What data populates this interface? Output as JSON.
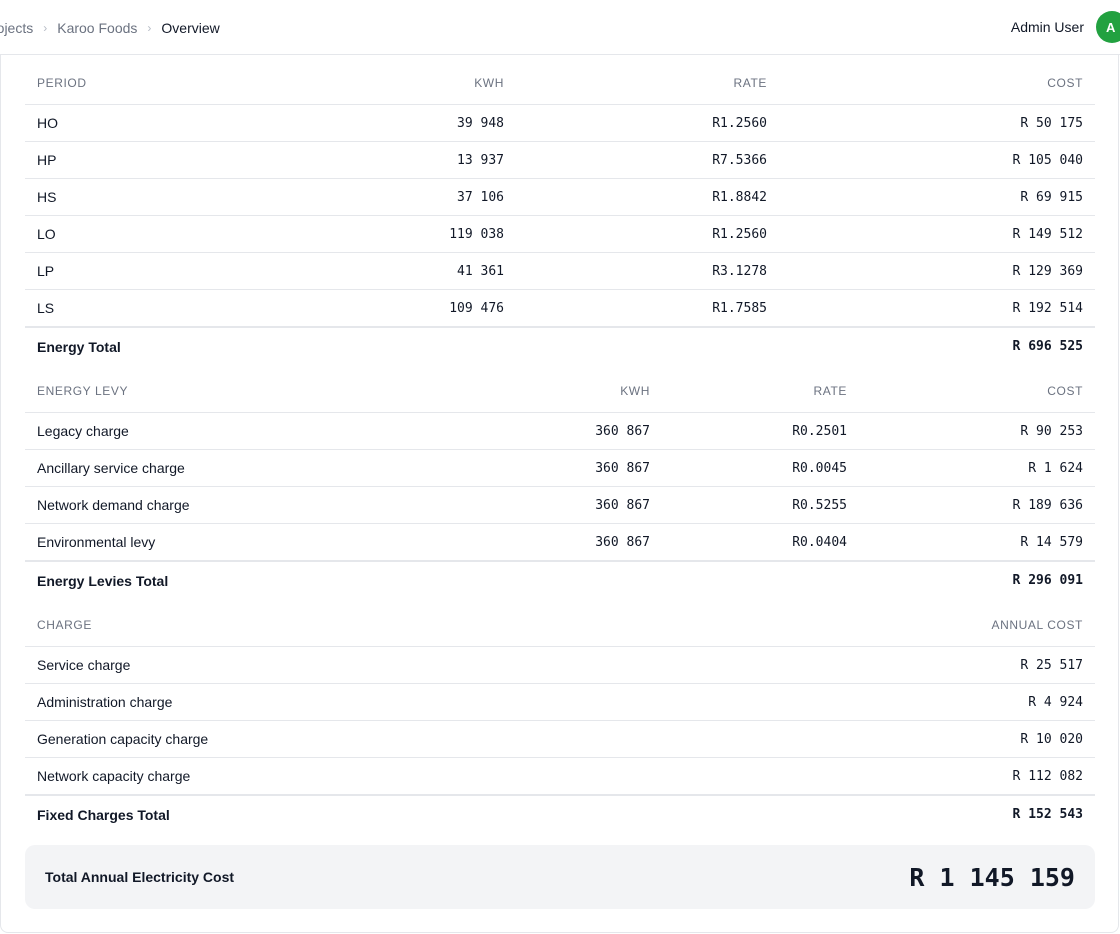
{
  "breadcrumb": [
    "rojects",
    "Karoo Foods",
    "Overview"
  ],
  "user": {
    "name": "Admin User",
    "initial": "A"
  },
  "energy": {
    "headers": [
      "PERIOD",
      "KWH",
      "RATE",
      "COST"
    ],
    "rows": [
      {
        "period": "HO",
        "kwh": "39 948",
        "rate": "R1.2560",
        "cost": "R 50 175"
      },
      {
        "period": "HP",
        "kwh": "13 937",
        "rate": "R7.5366",
        "cost": "R 105 040"
      },
      {
        "period": "HS",
        "kwh": "37 106",
        "rate": "R1.8842",
        "cost": "R 69 915"
      },
      {
        "period": "LO",
        "kwh": "119 038",
        "rate": "R1.2560",
        "cost": "R 149 512"
      },
      {
        "period": "LP",
        "kwh": "41 361",
        "rate": "R3.1278",
        "cost": "R 129 369"
      },
      {
        "period": "LS",
        "kwh": "109 476",
        "rate": "R1.7585",
        "cost": "R 192 514"
      }
    ],
    "total_label": "Energy Total",
    "total_value": "R 696 525"
  },
  "levy": {
    "headers": [
      "ENERGY LEVY",
      "KWH",
      "RATE",
      "COST"
    ],
    "rows": [
      {
        "name": "Legacy charge",
        "kwh": "360 867",
        "rate": "R0.2501",
        "cost": "R 90 253"
      },
      {
        "name": "Ancillary service charge",
        "kwh": "360 867",
        "rate": "R0.0045",
        "cost": "R 1 624"
      },
      {
        "name": "Network demand charge",
        "kwh": "360 867",
        "rate": "R0.5255",
        "cost": "R 189 636"
      },
      {
        "name": "Environmental levy",
        "kwh": "360 867",
        "rate": "R0.0404",
        "cost": "R 14 579"
      }
    ],
    "total_label": "Energy Levies Total",
    "total_value": "R 296 091"
  },
  "fixed": {
    "headers": [
      "CHARGE",
      "ANNUAL COST"
    ],
    "rows": [
      {
        "name": "Service charge",
        "cost": "R 25 517"
      },
      {
        "name": "Administration charge",
        "cost": "R 4 924"
      },
      {
        "name": "Generation capacity charge",
        "cost": "R 10 020"
      },
      {
        "name": "Network capacity charge",
        "cost": "R 112 082"
      }
    ],
    "total_label": "Fixed Charges Total",
    "total_value": "R 152 543"
  },
  "grand_total": {
    "label": "Total Annual Electricity Cost",
    "value": "R 1 145 159"
  }
}
